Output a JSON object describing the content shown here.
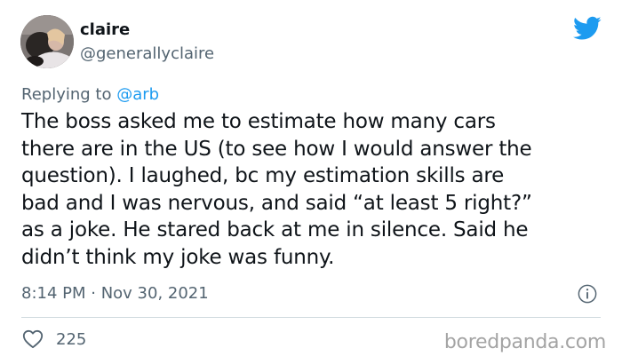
{
  "author": {
    "display_name": "claire",
    "handle": "@generallyclaire"
  },
  "reply": {
    "prefix": "Replying to",
    "mention": "@arb"
  },
  "tweet": {
    "lines": [
      "The boss asked me to estimate how many cars",
      "there are in the US (to see how I would answer the",
      "question). I laughed, bc my estimation skills are",
      "bad and I was nervous, and said “at least 5 right?”",
      "as a joke. He stared back at me in silence. Said he",
      "didn’t think my joke was funny."
    ],
    "timestamp": "8:14 PM · Nov 30, 2021"
  },
  "actions": {
    "like_count": "225"
  },
  "watermark": "boredpanda.com",
  "icons": {
    "brand": "twitter-bird-icon",
    "info": "info-icon",
    "like": "heart-icon"
  },
  "colors": {
    "accent": "#1d9bf0",
    "text": "#0f1419",
    "muted": "#536471",
    "divider": "#cfd9de",
    "watermark": "#a4a4a4"
  }
}
